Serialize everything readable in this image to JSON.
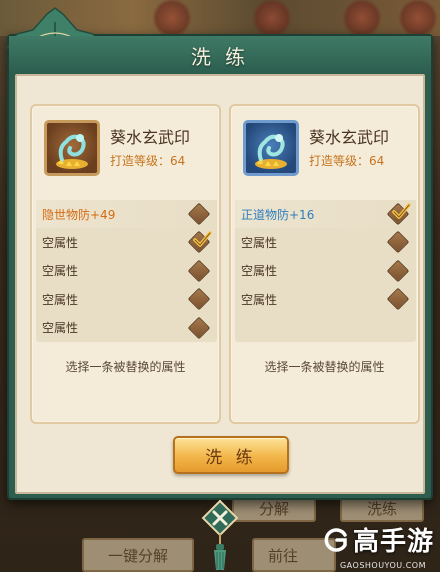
{
  "background": {
    "buttons": [
      "分解",
      "洗练",
      "一键分解",
      "前往"
    ]
  },
  "modal": {
    "title": "洗 练",
    "cards": [
      {
        "name": "葵水玄武印",
        "level_label": "打造等级：64",
        "frame_color": "#c59a5a",
        "attributes": [
          {
            "text": "隐世物防+49",
            "style": "orange",
            "marker": "diamond"
          },
          {
            "text": "空属性",
            "style": "normal",
            "marker": "check"
          },
          {
            "text": "空属性",
            "style": "normal",
            "marker": "diamond"
          },
          {
            "text": "空属性",
            "style": "normal",
            "marker": "diamond"
          },
          {
            "text": "空属性",
            "style": "normal",
            "marker": "diamond"
          }
        ],
        "hint": "选择一条被替换的属性"
      },
      {
        "name": "葵水玄武印",
        "level_label": "打造等级：64",
        "frame_color": "#6f9bcf",
        "attributes": [
          {
            "text": "正道物防+16",
            "style": "blue",
            "marker": "check"
          },
          {
            "text": "空属性",
            "style": "normal",
            "marker": "diamond"
          },
          {
            "text": "空属性",
            "style": "normal",
            "marker": "diamond"
          },
          {
            "text": "空属性",
            "style": "normal",
            "marker": "diamond"
          }
        ],
        "hint": "选择一条被替换的属性"
      }
    ],
    "action_button": "洗 练"
  },
  "watermark": {
    "brand": "高手游",
    "url": "GAOSHOUYOU.COM"
  },
  "colors": {
    "frame_green": "#2c5d4e",
    "parchment": "#efe7d3",
    "orange_attr": "#d56b12",
    "blue_attr": "#2c7fbe",
    "level_text": "#c6741c"
  }
}
